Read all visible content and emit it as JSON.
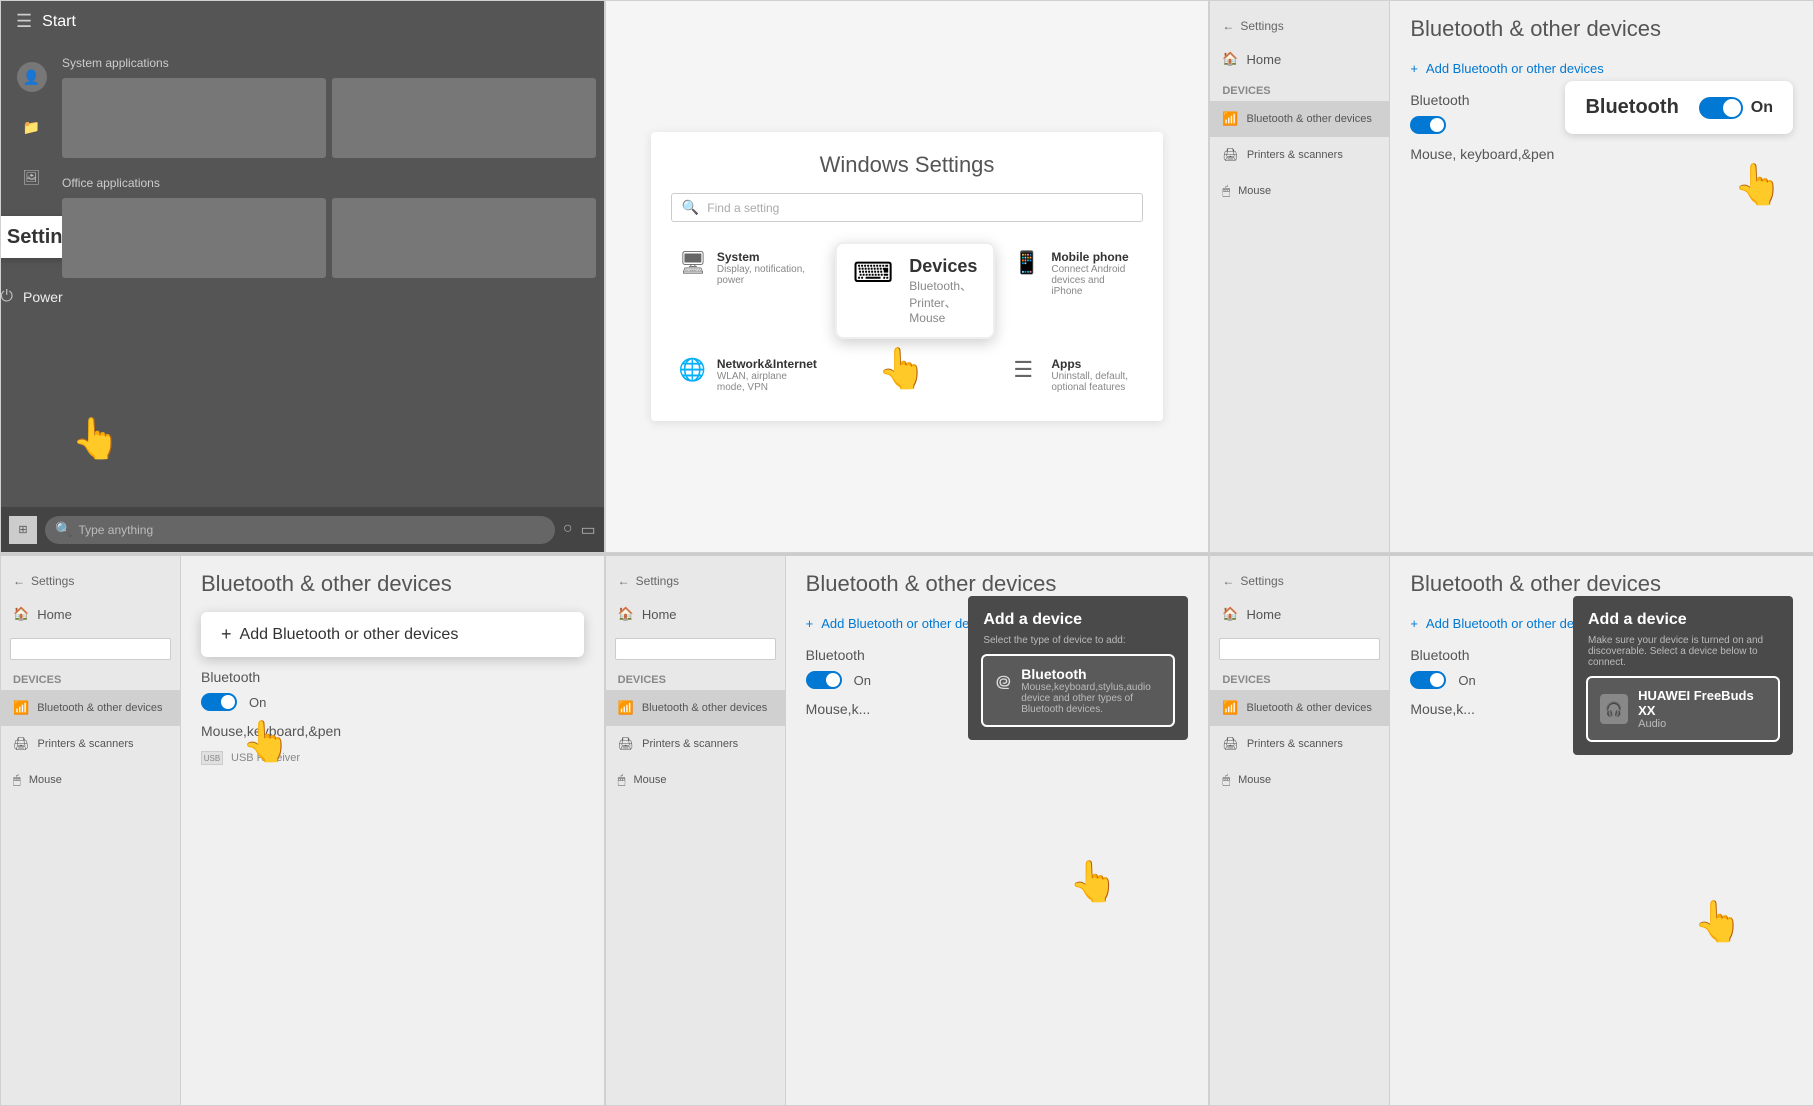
{
  "panels": {
    "p1": {
      "start_label": "Start",
      "section1": "System applications",
      "section2": "Office applications",
      "file_explorer": "File Explorer",
      "photo": "Photo",
      "settings": "Settings",
      "power": "Power",
      "search_placeholder": "Type anything"
    },
    "p2": {
      "title": "Windows Settings",
      "search_placeholder": "Find a setting",
      "devices_title": "Devices",
      "devices_desc": "Bluetooth、Printer、Mouse",
      "system_title": "System",
      "system_desc": "Display, notification, power",
      "mobile_title": "Mobile phone",
      "mobile_desc": "Connect Android devices and iPhone",
      "network_title": "Network&Internet",
      "network_desc": "WLAN, airplane mode, VPN",
      "apps_title": "Apps",
      "apps_desc": "Uninstall, default, optional features"
    },
    "p3": {
      "nav_back": "Settings",
      "home": "Home",
      "title": "Bluetooth & other devices",
      "add_btn": "Add Bluetooth or other devices",
      "devices_section": "Devices",
      "bt_label": "Bluetooth",
      "bt_status": "On",
      "mouse_label": "Mouse, keyboard,&pen",
      "bt_toggle_title": "Bluetooth",
      "bt_toggle_status": "On"
    },
    "p4": {
      "nav_back": "Settings",
      "home": "Home",
      "title": "Bluetooth & other devices",
      "add_btn": "Add Bluetooth or other devices",
      "devices_section": "Devices",
      "bt_label": "Bluetooth",
      "bt_status": "On",
      "mouse_label": "Mouse,keyboard,&pen",
      "usb": "USB Receiver"
    },
    "p5": {
      "nav_back": "Settings",
      "home": "Home",
      "title": "Bluetooth & other devices",
      "add_btn": "Add Bluetooth or other device",
      "devices_section": "Devices",
      "bt_label": "Bluetooth",
      "bt_status": "On",
      "mouse_label": "Mouse,k...",
      "dialog_title": "Add a device",
      "dialog_sub": "Select the type of device to add:",
      "bt_option_title": "Bluetooth",
      "bt_option_desc": "Mouse,keyboard,stylus,audio device and other types of Bluetooth devices."
    },
    "p6": {
      "nav_back": "Settings",
      "home": "Home",
      "title": "Bluetooth & other devices",
      "add_btn": "Add Bluetooth or other device",
      "devices_section": "Devices",
      "bt_label": "Bluetooth",
      "bt_status": "On",
      "mouse_label": "Mouse,k...",
      "dialog_title": "Add a device",
      "dialog_sub": "Make sure your device is turned on and discoverable. Select a device below to connect.",
      "device_name": "HUAWEI FreeBuds XX",
      "device_type": "Audio"
    }
  }
}
